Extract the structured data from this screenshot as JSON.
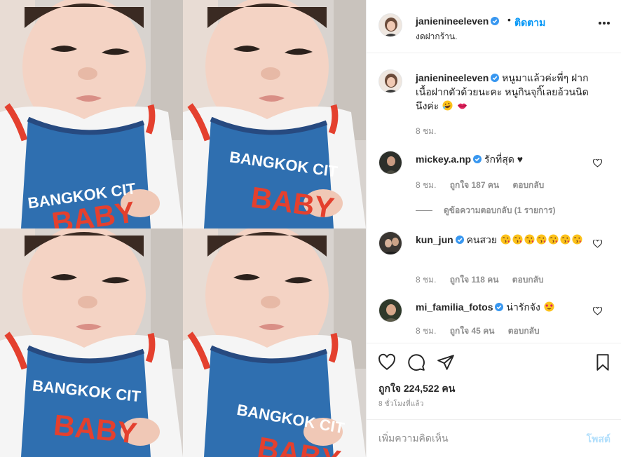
{
  "post": {
    "username": "janienineeleven",
    "verified": true,
    "follow_label": "ติดตาม",
    "separator": "•",
    "location": "งดฝากร้าน.",
    "more_icon": "more-horizontal-icon",
    "shirt_text": [
      "BANGKOK CIT",
      "BABY"
    ]
  },
  "caption": {
    "username": "janienineeleven",
    "text": "หนูมาแล้วค่ะพี่ๆ ฝากเนื้อฝากตัวด้วยนะคะ หนูกินจุกิ๊เลยอ้วนนิดนึงค่ะ",
    "emojis": [
      "rolling-laughing-emoji",
      "lips-emoji"
    ],
    "time": "8 ชม."
  },
  "comments": [
    {
      "username": "mickey.a.np",
      "text": "รักที่สุด ♥",
      "emojis": [],
      "time": "8 ชม.",
      "likes": "ถูกใจ 187 คน",
      "reply": "ตอบกลับ",
      "view_replies": "ดูข้อความตอบกลับ (1 รายการ)"
    },
    {
      "username": "kun_jun",
      "text": "คนสวย",
      "emojis": [
        "kissing-face-emoji",
        "kissing-face-emoji",
        "kissing-face-emoji",
        "kissing-face-emoji",
        "kissing-face-emoji",
        "kissing-face-emoji",
        "kissing-face-emoji"
      ],
      "time": "8 ชม.",
      "likes": "ถูกใจ 118 คน",
      "reply": "ตอบกลับ"
    },
    {
      "username": "mi_familia_fotos",
      "text": "น่ารักจัง",
      "emojis": [
        "heart-eyes-emoji"
      ],
      "time": "8 ชม.",
      "likes": "ถูกใจ 45 คน",
      "reply": "ตอบกลับ"
    }
  ],
  "actions": {
    "like_icon": "heart-icon",
    "comment_icon": "comment-icon",
    "share_icon": "paper-plane-icon",
    "save_icon": "bookmark-icon",
    "likes_total": "ถูกใจ 224,522 คน",
    "timestamp": "8 ชั่วโมงที่แล้ว"
  },
  "add_comment": {
    "placeholder": "เพิ่มความคิดเห็น",
    "post_label": "โพสต์"
  },
  "colors": {
    "link_blue": "#0095f6",
    "post_disabled": "#b2dffc",
    "verified": "#3897f0",
    "muted": "#8e8e8e"
  }
}
